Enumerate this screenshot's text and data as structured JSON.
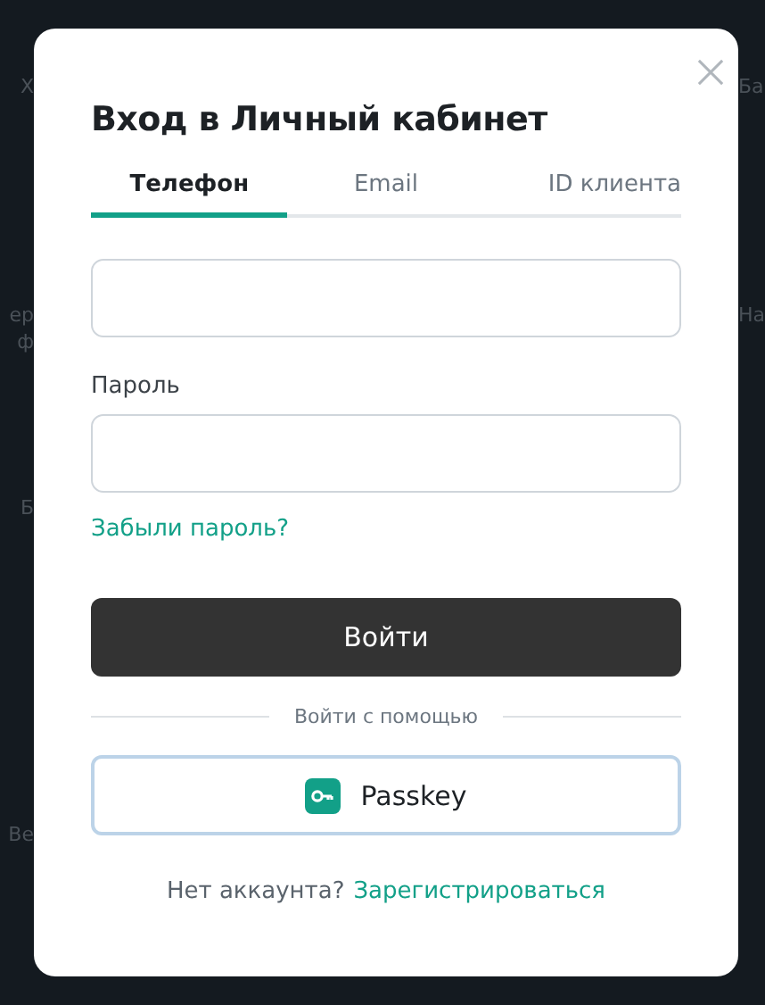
{
  "background": {
    "left_fragments": [
      "Х",
      "ер",
      "ф",
      "Б",
      "Ве"
    ],
    "right_fragments": [
      "Ба",
      "На"
    ]
  },
  "dialog": {
    "title": "Вход в Личный кабинет",
    "tabs": [
      {
        "label": "Телефон",
        "selected": true
      },
      {
        "label": "Email",
        "selected": false
      },
      {
        "label": "ID клиента",
        "selected": false
      }
    ],
    "password_label": "Пароль",
    "forgot_link": "Забыли пароль?",
    "submit_button": "Войти",
    "divider_text": "Войти с помощью",
    "passkey_button": "Passkey",
    "footer_text": "Нет аккаунта?",
    "register_link": "Зарегистрироваться"
  }
}
